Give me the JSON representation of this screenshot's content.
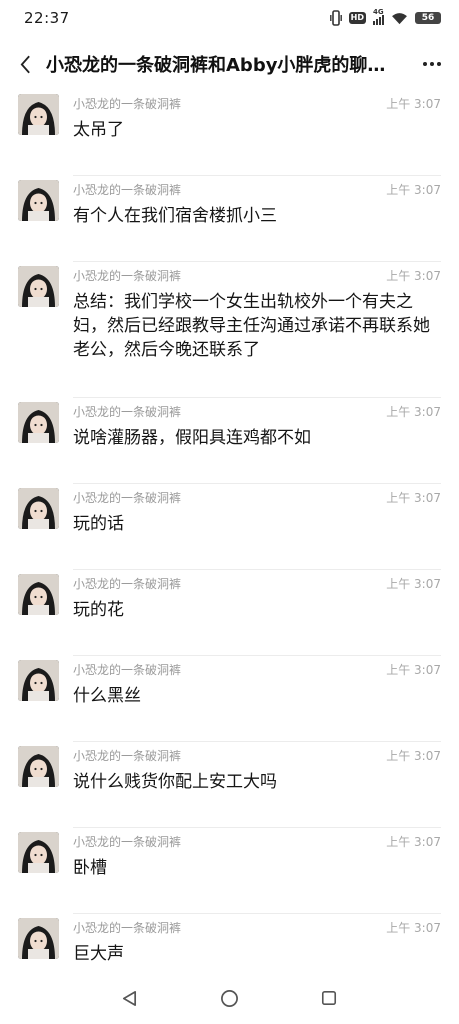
{
  "status_bar": {
    "time": "22:37",
    "network": "4G",
    "hd": "HD",
    "battery": "56"
  },
  "header": {
    "title": "小恐龙的一条破洞裤和Abby小胖虎的聊…",
    "back_icon": "chevron-left-icon",
    "more_icon": "more-dots-icon"
  },
  "messages": [
    {
      "sender": "小恐龙的一条破洞裤",
      "time": "上午 3:07",
      "text": "太吊了"
    },
    {
      "sender": "小恐龙的一条破洞裤",
      "time": "上午 3:07",
      "text": "有个人在我们宿舍楼抓小三"
    },
    {
      "sender": "小恐龙的一条破洞裤",
      "time": "上午 3:07",
      "text": "总结：我们学校一个女生出轨校外一个有夫之妇，然后已经跟教导主任沟通过承诺不再联系她老公，然后今晚还联系了"
    },
    {
      "sender": "小恐龙的一条破洞裤",
      "time": "上午 3:07",
      "text": "说啥灌肠器，假阳具连鸡都不如"
    },
    {
      "sender": "小恐龙的一条破洞裤",
      "time": "上午 3:07",
      "text": "玩的话"
    },
    {
      "sender": "小恐龙的一条破洞裤",
      "time": "上午 3:07",
      "text": "玩的花"
    },
    {
      "sender": "小恐龙的一条破洞裤",
      "time": "上午 3:07",
      "text": "什么黑丝"
    },
    {
      "sender": "小恐龙的一条破洞裤",
      "time": "上午 3:07",
      "text": "说什么贱货你配上安工大吗"
    },
    {
      "sender": "小恐龙的一条破洞裤",
      "time": "上午 3:07",
      "text": "卧槽"
    },
    {
      "sender": "小恐龙的一条破洞裤",
      "time": "上午 3:07",
      "text": "巨大声"
    }
  ],
  "nav_bar": {
    "back_icon": "triangle-back-icon",
    "home_icon": "circle-home-icon",
    "recents_icon": "square-recents-icon"
  }
}
